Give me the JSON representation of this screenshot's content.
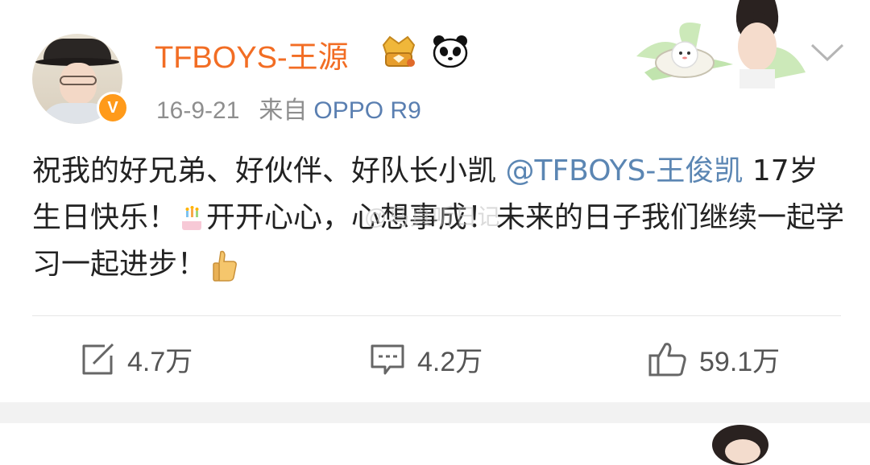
{
  "post": {
    "username": "TFBOYS-王源",
    "verified_badge": "V",
    "timestamp": "16-9-21",
    "source_prefix": "来自",
    "source": "OPPO R9",
    "content": {
      "line1_text": "祝我的好兄弟、好伙伴、好队长小凯 ",
      "mention": "@TFBOYS-王俊凯",
      "line2_text": " 17岁生日快乐！",
      "line2_rest": "开开心心，心想事成！未来的日子我们继续一起学习一起进步！"
    },
    "watermark": "@马真听日记",
    "actions": {
      "repost_count": "4.7万",
      "comment_count": "4.2万",
      "like_count": "59.1万"
    }
  },
  "icons": {
    "verified": "verified-v-icon",
    "crown": "crown-badge-icon",
    "panda": "panda-icon",
    "dropdown": "chevron-down-icon",
    "repost": "repost-icon",
    "comment": "comment-icon",
    "like": "thumbs-up-icon",
    "cake": "birthday-cake-emoji",
    "thumb": "thumbs-up-emoji"
  },
  "colors": {
    "username": "#f26d24",
    "mention": "#5b86b3",
    "source": "#5a7fb1",
    "meta": "#8e8e8e",
    "badge": "#ff9a1a"
  }
}
